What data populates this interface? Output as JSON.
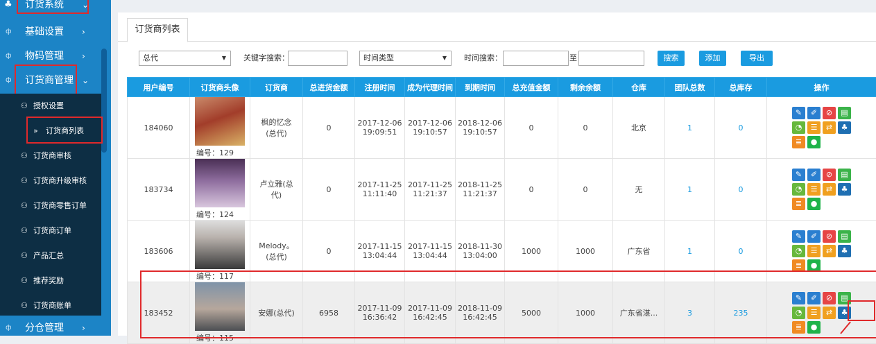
{
  "sidebar": {
    "sections": [
      {
        "label": "订货系统",
        "chevron": "⌄",
        "icon": "sitemap-icon"
      },
      {
        "label": "基础设置",
        "chevron": "›"
      },
      {
        "label": "物码管理",
        "chevron": "›"
      },
      {
        "label": "订货商管理",
        "chevron": "⌄"
      }
    ],
    "submenu": [
      {
        "label": "授权设置",
        "icon": "users-icon"
      },
      {
        "label": "订货商列表",
        "icon": "double-chevron-icon"
      },
      {
        "label": "订货商审核",
        "icon": "users-icon"
      },
      {
        "label": "订货商升级审核",
        "icon": "users-icon"
      },
      {
        "label": "订货商零售订单",
        "icon": "users-icon"
      },
      {
        "label": "订货商订单",
        "icon": "users-icon"
      },
      {
        "label": "产品汇总",
        "icon": "users-icon"
      },
      {
        "label": "推荐奖励",
        "icon": "users-icon"
      },
      {
        "label": "订货商账单",
        "icon": "users-icon"
      }
    ],
    "bottom": {
      "label": "分仓管理",
      "chevron": "›"
    }
  },
  "tab": {
    "label": "订货商列表"
  },
  "filters": {
    "level_select": "总代",
    "keyword_label": "关键字搜索：",
    "time_type_select": "时间类型",
    "time_search_label": "时间搜索：",
    "to_label": "至",
    "search_button": "搜索",
    "add_button": "添加",
    "export_button": "导出"
  },
  "table": {
    "headers": [
      "用户编号",
      "订货商头像",
      "订货商",
      "总进货金额",
      "注册时间",
      "成为代理时间",
      "到期时间",
      "总充值金额",
      "剩余余额",
      "仓库",
      "团队总数",
      "总库存",
      "操作"
    ],
    "rows": [
      {
        "id": "184060",
        "code": "编号：129",
        "name": "枫的忆念\n(总代)",
        "purchase": "0",
        "reg": "2017-12-06\n19:09:51",
        "agent": "2017-12-06\n19:10:57",
        "expire": "2018-12-06\n19:10:57",
        "recharge": "0",
        "balance": "0",
        "warehouse": "北京",
        "team": "1",
        "stock": "0"
      },
      {
        "id": "183734",
        "code": "编号：124",
        "name": "卢立雅(总\n代)",
        "purchase": "0",
        "reg": "2017-11-25\n11:11:40",
        "agent": "2017-11-25\n11:21:37",
        "expire": "2018-11-25\n11:21:37",
        "recharge": "0",
        "balance": "0",
        "warehouse": "无",
        "team": "1",
        "stock": "0"
      },
      {
        "id": "183606",
        "code": "编号：117",
        "name": "Melody。\n(总代)",
        "purchase": "0",
        "reg": "2017-11-15\n13:04:44",
        "agent": "2017-11-15\n13:04:44",
        "expire": "2018-11-30\n13:04:00",
        "recharge": "1000",
        "balance": "1000",
        "warehouse": "广东省",
        "team": "1",
        "stock": "0"
      },
      {
        "id": "183452",
        "code": "编号：115",
        "name": "安娜(总代)",
        "purchase": "6958",
        "reg": "2017-11-09\n16:36:42",
        "agent": "2017-11-09\n16:42:45",
        "expire": "2018-11-09\n16:42:45",
        "recharge": "5000",
        "balance": "1000",
        "warehouse": "广东省湛...",
        "team": "3",
        "stock": "235"
      }
    ],
    "ops": [
      {
        "icon": "edit-profile-icon",
        "glyph": "✎",
        "color": "#2a7fd0"
      },
      {
        "icon": "pencil-icon",
        "glyph": "✐",
        "color": "#2a7fd0"
      },
      {
        "icon": "ban-icon",
        "glyph": "⊘",
        "color": "#e64545"
      },
      {
        "icon": "document-icon",
        "glyph": "▤",
        "color": "#3bb34a"
      },
      {
        "icon": "chat-bubble-icon",
        "glyph": "◔",
        "color": "#67b83c"
      },
      {
        "icon": "list-icon",
        "glyph": "☰",
        "color": "#f0a020"
      },
      {
        "icon": "transfer-icon",
        "glyph": "⇄",
        "color": "#f0a020"
      },
      {
        "icon": "sitemap-icon",
        "glyph": "♣",
        "color": "#1f6fb2"
      },
      {
        "icon": "report-icon",
        "glyph": "≣",
        "color": "#f08a22"
      },
      {
        "icon": "message-icon",
        "glyph": "●",
        "color": "#1fb34a"
      }
    ]
  },
  "colors": {
    "sidebar": "#1c84c6",
    "submenu": "#0d2e44",
    "accent": "#1a9be0",
    "highlight": "#e0292b"
  }
}
